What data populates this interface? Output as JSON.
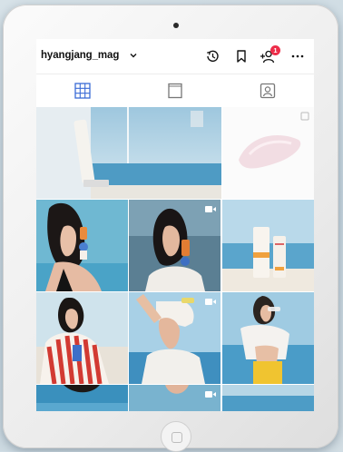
{
  "profile": {
    "username": "hyangjang_mag"
  },
  "topbar_icons": [
    "chevron-down-icon",
    "history-icon",
    "bookmark-icon",
    "add-user-icon",
    "more-icon"
  ],
  "notification_badge": "1",
  "tabs": [
    {
      "name": "grid-icon",
      "active": true
    },
    {
      "name": "feed-icon",
      "active": false
    },
    {
      "name": "tagged-icon",
      "active": false
    }
  ],
  "colors": {
    "accent": "#3a6bd6",
    "badge": "#ed2d49",
    "text": "#111111"
  }
}
